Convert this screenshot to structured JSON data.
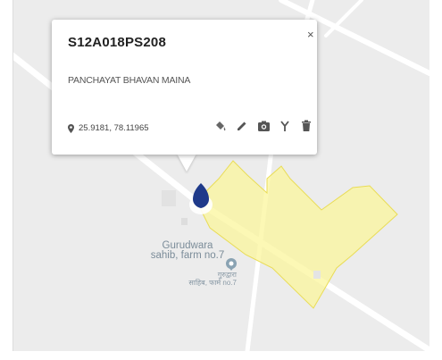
{
  "map": {
    "place_name": "Gurudwara sahib, farm no.7",
    "place_name_line1": "Gurudwara",
    "place_name_line2": "sahib, farm no.7",
    "place_name_hindi_line1": "गुरुद्वारा",
    "place_name_hindi_line2": "साहिब, फार्म no.7",
    "boundary_color": "#fbf59c",
    "boundary_stroke": "#e9dc55",
    "marker_color": "#1f3a8a",
    "poi_color": "#8aa3b3"
  },
  "popup": {
    "title": "S12A018PS208",
    "close_label": "×",
    "description": "PANCHAYAT BHAVAN MAINA",
    "coordinates": "25.9181, 78.11965",
    "location_icon": "pin-icon",
    "actions": [
      {
        "name": "fill-color-button",
        "icon": "paint-bucket-icon"
      },
      {
        "name": "edit-button",
        "icon": "pencil-icon"
      },
      {
        "name": "add-photo-button",
        "icon": "camera-icon"
      },
      {
        "name": "style-button",
        "icon": "branch-icon"
      },
      {
        "name": "delete-button",
        "icon": "trash-icon"
      }
    ]
  }
}
